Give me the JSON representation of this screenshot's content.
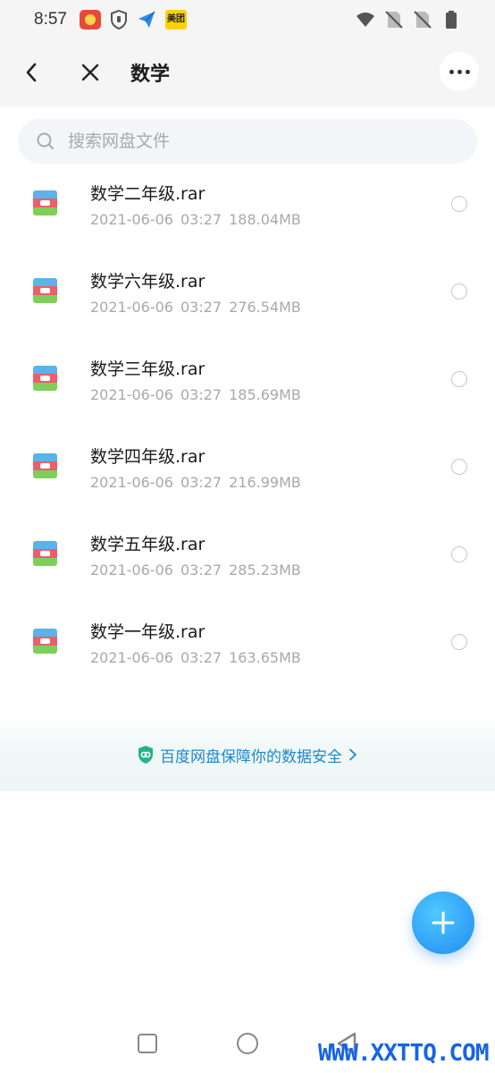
{
  "status_bar": {
    "time": "8:57",
    "notification_icons": [
      "app-badge-icon",
      "shield-icon",
      "send-icon",
      "meituan-icon"
    ],
    "meituan_label": "美团",
    "system_icons": [
      "wifi-icon",
      "no-sim-icon",
      "no-sim-icon",
      "battery-icon"
    ]
  },
  "header": {
    "title": "数学"
  },
  "search": {
    "placeholder": "搜索网盘文件"
  },
  "files": [
    {
      "name": "数学二年级.rar",
      "date": "2021-06-06",
      "time": "03:27",
      "size": "188.04MB"
    },
    {
      "name": "数学六年级.rar",
      "date": "2021-06-06",
      "time": "03:27",
      "size": "276.54MB"
    },
    {
      "name": "数学三年级.rar",
      "date": "2021-06-06",
      "time": "03:27",
      "size": "185.69MB"
    },
    {
      "name": "数学四年级.rar",
      "date": "2021-06-06",
      "time": "03:27",
      "size": "216.99MB"
    },
    {
      "name": "数学五年级.rar",
      "date": "2021-06-06",
      "time": "03:27",
      "size": "285.23MB"
    },
    {
      "name": "数学一年级.rar",
      "date": "2021-06-06",
      "time": "03:27",
      "size": "163.65MB"
    }
  ],
  "security_banner": {
    "text": "百度网盘保障你的数据安全"
  },
  "watermark": "WWW.XXTTQ.COM",
  "colors": {
    "accent": "#2e9df6",
    "banner_text": "#1f86c8",
    "header_bg": "#f5f5f5",
    "meta_text": "#a6a9ae"
  }
}
